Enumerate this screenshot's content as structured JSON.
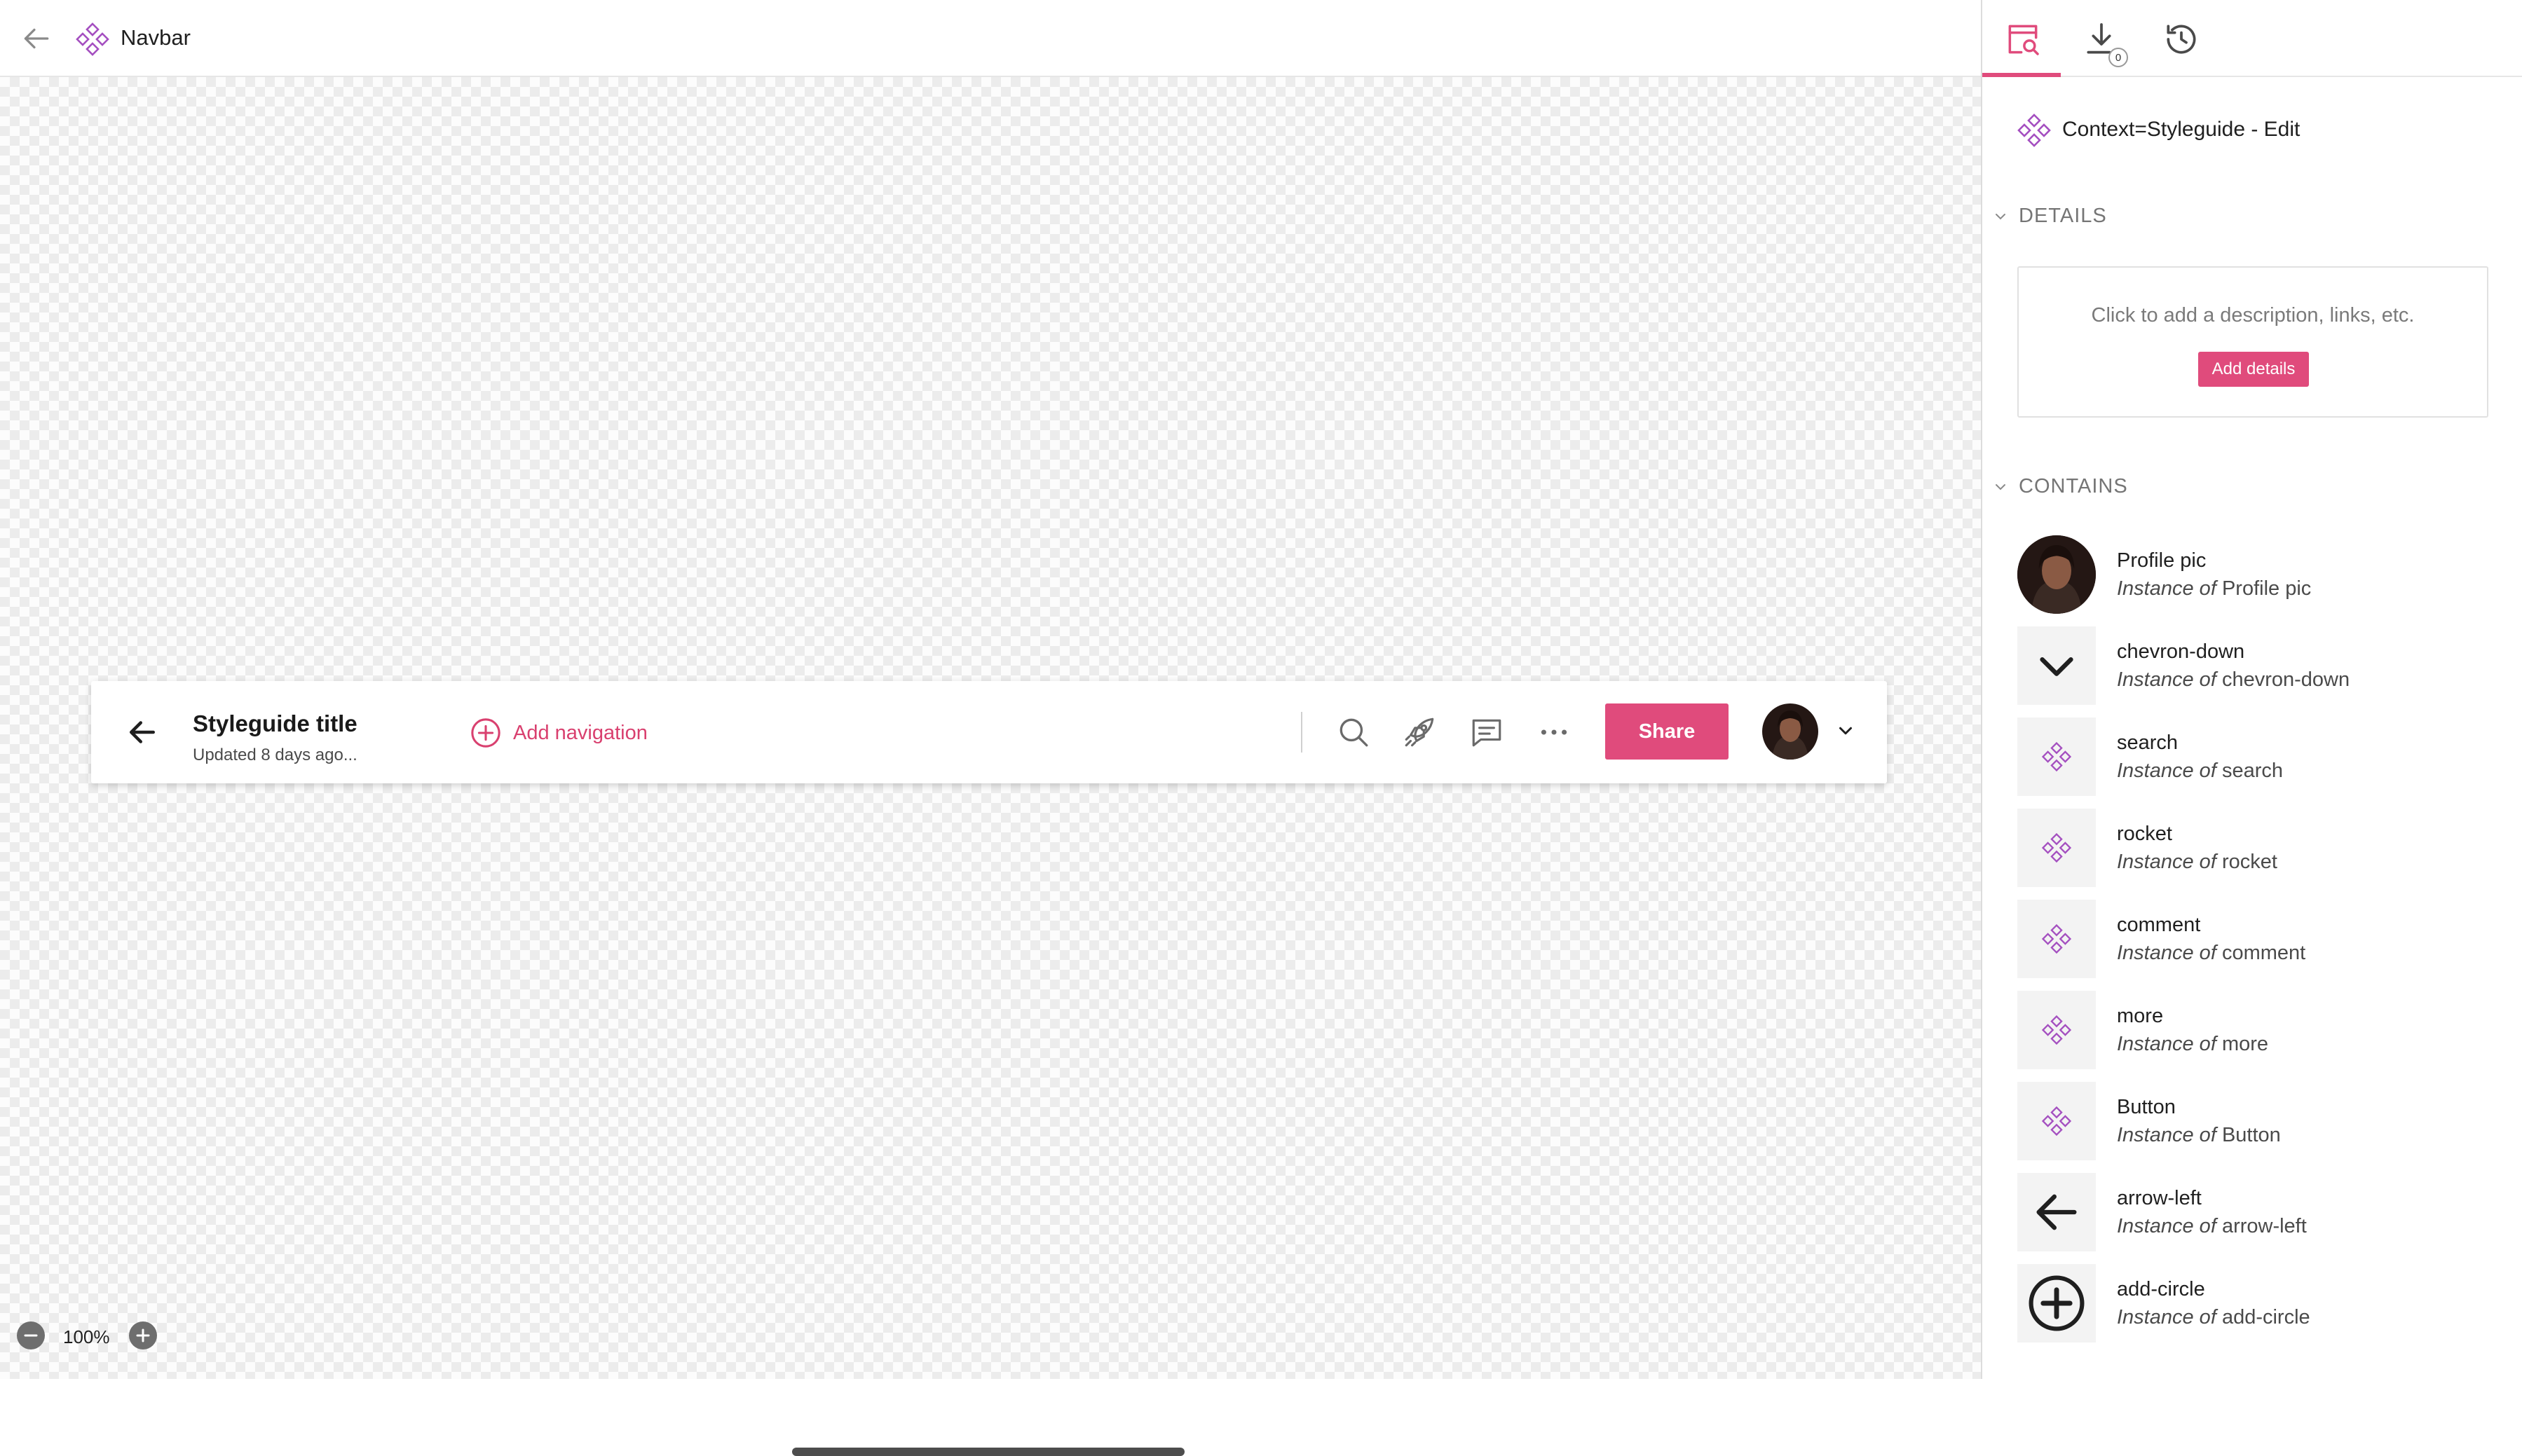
{
  "header": {
    "title": "Navbar"
  },
  "navbar": {
    "title": "Styleguide title",
    "subtitle": "Updated 8 days ago...",
    "add_navigation": "Add navigation",
    "share_label": "Share"
  },
  "zoom": {
    "level": "100%"
  },
  "panel": {
    "download_count": "0",
    "component_name": "Context=Styleguide - Edit",
    "details": {
      "heading": "DETAILS",
      "hint": "Click to add a description, links, etc.",
      "button": "Add details"
    },
    "contains": {
      "heading": "CONTAINS",
      "instance_prefix": "Instance of",
      "items": [
        {
          "name": "Profile pic",
          "thumb": "profile-photo"
        },
        {
          "name": "chevron-down",
          "thumb": "chevron-down-icon"
        },
        {
          "name": "search",
          "thumb": "component-icon"
        },
        {
          "name": "rocket",
          "thumb": "component-icon"
        },
        {
          "name": "comment",
          "thumb": "component-icon"
        },
        {
          "name": "more",
          "thumb": "component-icon"
        },
        {
          "name": "Button",
          "thumb": "component-icon"
        },
        {
          "name": "arrow-left",
          "thumb": "arrow-left-icon"
        },
        {
          "name": "add-circle",
          "thumb": "add-circle-icon"
        }
      ]
    }
  },
  "colors": {
    "accent": "#e04b7c",
    "component_purple": "#a44fc0"
  }
}
